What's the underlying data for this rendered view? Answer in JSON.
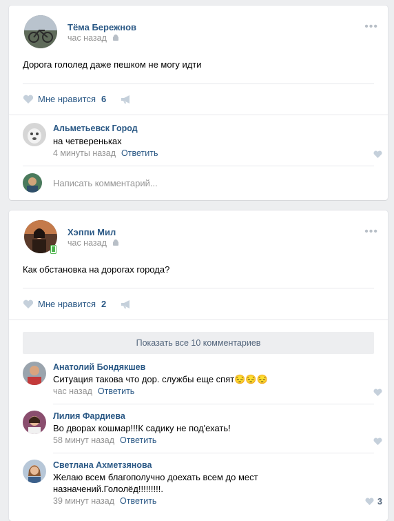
{
  "posts": [
    {
      "author": "Тёма Бережнов",
      "time": "час назад",
      "text": "Дорога гололед даже пешком не могу идти",
      "like_label": "Мне нравится",
      "like_count": "6",
      "comments": [
        {
          "author": "Альметьевск Город",
          "text": "на четвереньках",
          "time": "4 минуты назад",
          "reply": "Ответить"
        }
      ],
      "comment_placeholder": "Написать комментарий..."
    },
    {
      "author": "Хэппи Мил",
      "time": "час назад",
      "text": "Как обстановка на дорогах города?",
      "like_label": "Мне нравится",
      "like_count": "2",
      "show_all": "Показать все 10 комментариев",
      "comments": [
        {
          "author": "Анатолий Бондякшев",
          "text": "Ситуация такова что дор. службы еще спят😔😔😔",
          "time": "час назад",
          "reply": "Ответить"
        },
        {
          "author": "Лилия Фардиева",
          "text": "Во дворах кошмар!!!К садику не под'ехать!",
          "time": "58 минут назад",
          "reply": "Ответить"
        },
        {
          "author": "Светлана Ахметзянова",
          "text": "Желаю всем благополучно доехать всем до мест назначений.Гололёд!!!!!!!!!.",
          "time": "39 минут назад",
          "reply": "Ответить",
          "like_count": "3"
        }
      ]
    }
  ],
  "colors": {
    "link": "#2a5885",
    "muted": "#939393",
    "background": "#edeef0",
    "icon": "#b8bfc7"
  },
  "icons": [
    "android-icon",
    "heart-icon",
    "megaphone-icon",
    "more-icon"
  ]
}
